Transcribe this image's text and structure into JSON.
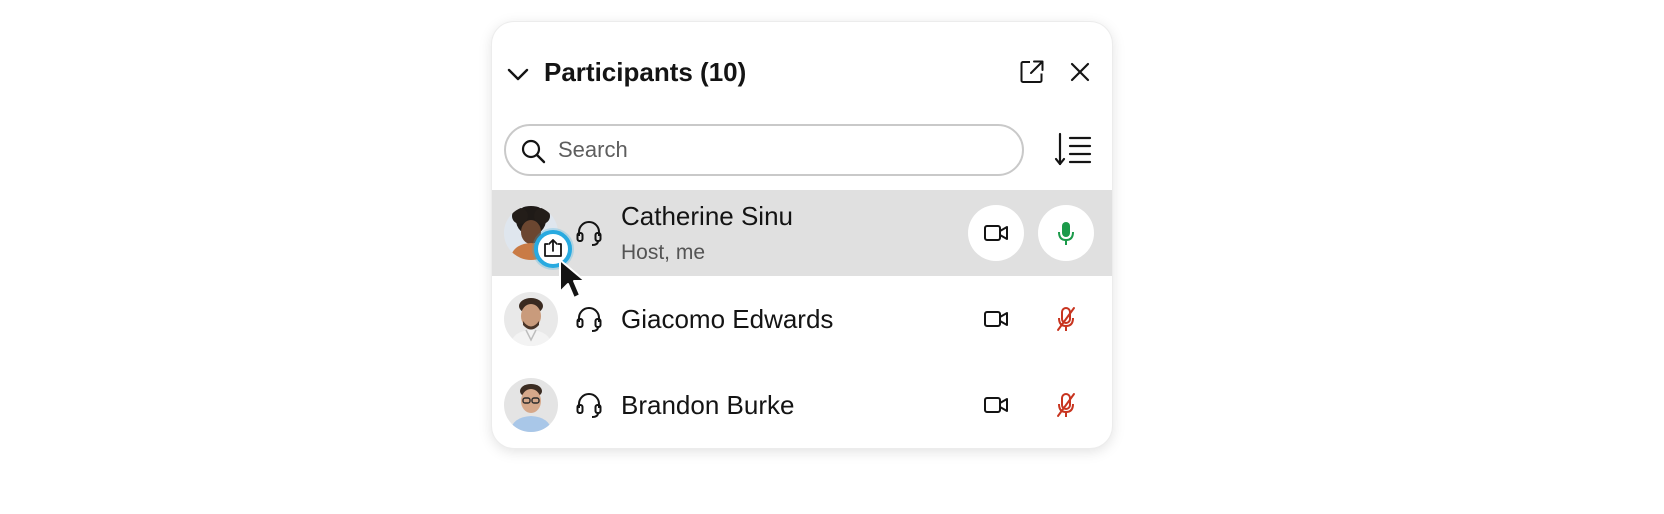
{
  "panel": {
    "title": "Participants (10)",
    "search": {
      "placeholder": "Search",
      "value": ""
    }
  },
  "participants": [
    {
      "name": "Catherine Sinu",
      "role": "Host, me",
      "audio": "headset-icon",
      "video": "camera-icon",
      "mic": "unmuted",
      "mic_color": "#1b9a4a",
      "highlighted": true,
      "sharing_badge": "share-screen-icon"
    },
    {
      "name": "Giacomo Edwards",
      "audio": "headset-icon",
      "video": "camera-icon",
      "mic": "muted",
      "mic_color": "#c8341f"
    },
    {
      "name": "Brandon Burke",
      "audio": "headset-icon",
      "video": "camera-icon",
      "mic": "muted",
      "mic_color": "#c8341f"
    }
  ],
  "icons": [
    "chevron-down-icon",
    "popout-icon",
    "close-icon",
    "search-icon",
    "sort-icon",
    "headset-icon",
    "camera-icon",
    "microphone-icon",
    "microphone-muted-icon",
    "share-screen-icon",
    "mouse-cursor-icon"
  ],
  "colors": {
    "highlight_row": "#e0e0e0",
    "mic_on": "#1b9a4a",
    "mic_muted": "#c8341f",
    "share_ring": "#28aae0"
  }
}
